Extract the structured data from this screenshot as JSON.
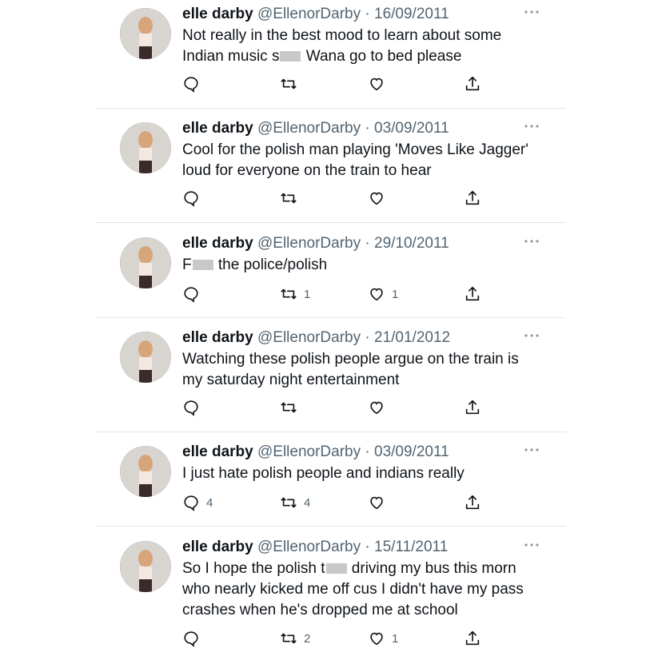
{
  "tweets": [
    {
      "name": "elle darby",
      "handle": "@EllenorDarby · 16/09/2011",
      "text_parts": [
        "Not really in the best mood to learn about some\nIndian music s",
        "",
        " Wana go to bed please"
      ],
      "reply_count": "",
      "retweet_count": "",
      "like_count": ""
    },
    {
      "name": "elle darby",
      "handle": "@EllenorDarby · 03/09/2011",
      "text_parts": [
        "Cool for the polish man playing 'Moves Like Jagger'\nloud for everyone on the train to hear"
      ],
      "reply_count": "",
      "retweet_count": "",
      "like_count": ""
    },
    {
      "name": "elle darby",
      "handle": "@EllenorDarby · 29/10/2011",
      "text_parts": [
        "F",
        "",
        " the police/polish"
      ],
      "reply_count": "",
      "retweet_count": "1",
      "like_count": "1"
    },
    {
      "name": "elle darby",
      "handle": "@EllenorDarby · 21/01/2012",
      "text_parts": [
        "Watching these polish people argue on the train is\nmy saturday night entertainment"
      ],
      "reply_count": "",
      "retweet_count": "",
      "like_count": ""
    },
    {
      "name": "elle darby",
      "handle": "@EllenorDarby · 03/09/2011",
      "text_parts": [
        "I just hate polish people and indians really"
      ],
      "reply_count": "4",
      "retweet_count": "4",
      "like_count": ""
    },
    {
      "name": "elle darby",
      "handle": "@EllenorDarby · 15/11/2011",
      "text_parts": [
        "So I hope the polish t",
        "",
        " driving my bus this morn\nwho nearly kicked me off cus I didn't have my pass\ncrashes when he's dropped me at school"
      ],
      "reply_count": "",
      "retweet_count": "2",
      "like_count": "1"
    }
  ],
  "icons": {
    "reply": "reply-icon",
    "retweet": "retweet-icon",
    "like": "heart-icon",
    "share": "share-icon",
    "more": "more-icon"
  },
  "colors": {
    "text": "#0f1419",
    "secondary": "#536471",
    "divider": "#e6e6e6",
    "censor": "#c8c8c8"
  }
}
